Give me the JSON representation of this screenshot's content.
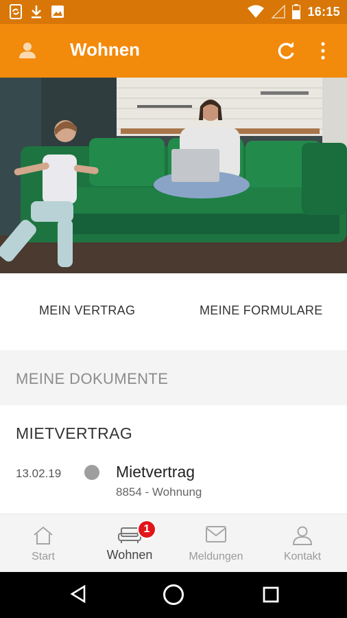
{
  "statusbar": {
    "time": "16:15",
    "left_icons": [
      "phone-sync-icon",
      "download-icon",
      "image-icon"
    ],
    "right_icons": [
      "wifi-icon",
      "signal-icon",
      "battery-icon"
    ]
  },
  "appbar": {
    "title": "Wohnen",
    "color": "#f28a0c",
    "icons": [
      "account-icon",
      "refresh-icon",
      "more-vert-icon"
    ]
  },
  "hero": {
    "icon": "hero-photo"
  },
  "links": {
    "contract": "MEIN VERTRAG",
    "forms": "MEINE FORMULARE"
  },
  "documents": {
    "search_label": "MEINE DOKUMENTE",
    "section_title": "MIETVERTRAG",
    "items": [
      {
        "date": "13.02.19",
        "title": "Mietvertrag",
        "subtitle": "8854 - Wohnung"
      }
    ]
  },
  "bottom_nav": {
    "items": [
      {
        "label": "Start",
        "icon": "home-icon"
      },
      {
        "label": "Wohnen",
        "icon": "sofa-icon",
        "badge": "1"
      },
      {
        "label": "Meldungen",
        "icon": "mail-icon"
      },
      {
        "label": "Kontakt",
        "icon": "person-icon"
      }
    ],
    "active": "Wohnen",
    "badge_color": "#e0161b"
  },
  "system_nav": [
    "back-icon",
    "home-circle-icon",
    "recents-icon"
  ]
}
